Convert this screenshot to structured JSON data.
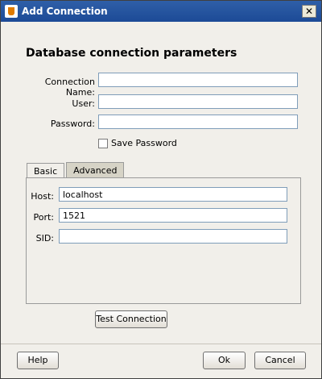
{
  "window": {
    "title": "Add Connection",
    "close_glyph": "✕"
  },
  "main": {
    "section_title": "Database connection parameters",
    "fields": {
      "connection_name": {
        "label": "Connection Name:",
        "value": ""
      },
      "user": {
        "label": "User:",
        "value": ""
      },
      "password": {
        "label": "Password:",
        "value": ""
      }
    },
    "save_password": {
      "label": "Save Password",
      "checked": false
    },
    "tabs": [
      {
        "label": "Basic",
        "active": true
      },
      {
        "label": "Advanced",
        "active": false
      }
    ],
    "basic": {
      "host": {
        "label": "Host:",
        "value": "localhost"
      },
      "port": {
        "label": "Port:",
        "value": "1521"
      },
      "sid": {
        "label": "SID:",
        "value": ""
      }
    },
    "test_connection_label": "Test Connection"
  },
  "footer": {
    "help_label": "Help",
    "ok_label": "Ok",
    "cancel_label": "Cancel"
  }
}
